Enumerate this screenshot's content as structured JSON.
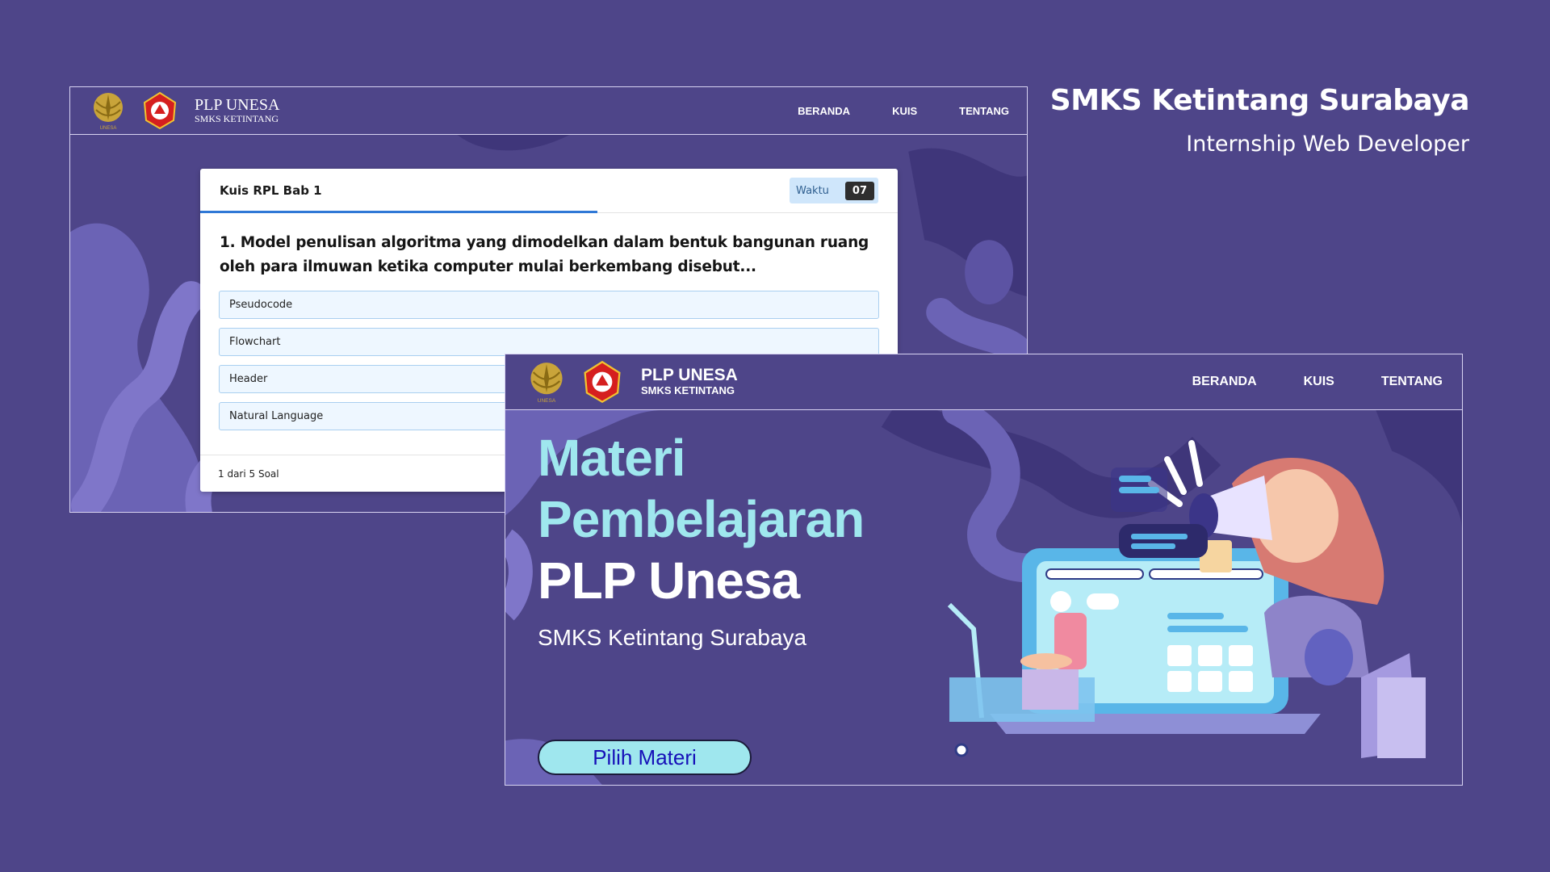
{
  "caption": {
    "title": "SMKS Ketintang Surabaya",
    "subtitle": "Internship Web Developer"
  },
  "brand": {
    "name": "PLP UNESA",
    "sub": "SMKS KETINTANG",
    "logo_gold_text": "UNESA"
  },
  "nav": {
    "items": [
      "BERANDA",
      "KUIS",
      "TENTANG"
    ]
  },
  "quiz": {
    "title": "Kuis RPL Bab 1",
    "timer_label": "Waktu",
    "timer_value": "07",
    "question": "1. Model penulisan algoritma yang dimodelkan dalam bentuk bangunan ruang oleh para ilmuwan ketika computer mulai berkembang disebut...",
    "options": [
      "Pseudocode",
      "Flowchart",
      "Header",
      "Natural Language"
    ],
    "footer": "1 dari 5 Soal",
    "progress_fraction": 0.57
  },
  "materi": {
    "heading_line1": "Materi",
    "heading_line2": "Pembelajaran",
    "heading_line3": "PLP Unesa",
    "subheading": "SMKS Ketintang Surabaya",
    "cta_label": "Pilih Materi"
  },
  "colors": {
    "background": "#4e4589",
    "accent_cyan": "#9fe7ee",
    "cta_text": "#1610b8",
    "progress_blue": "#2f78d6"
  }
}
